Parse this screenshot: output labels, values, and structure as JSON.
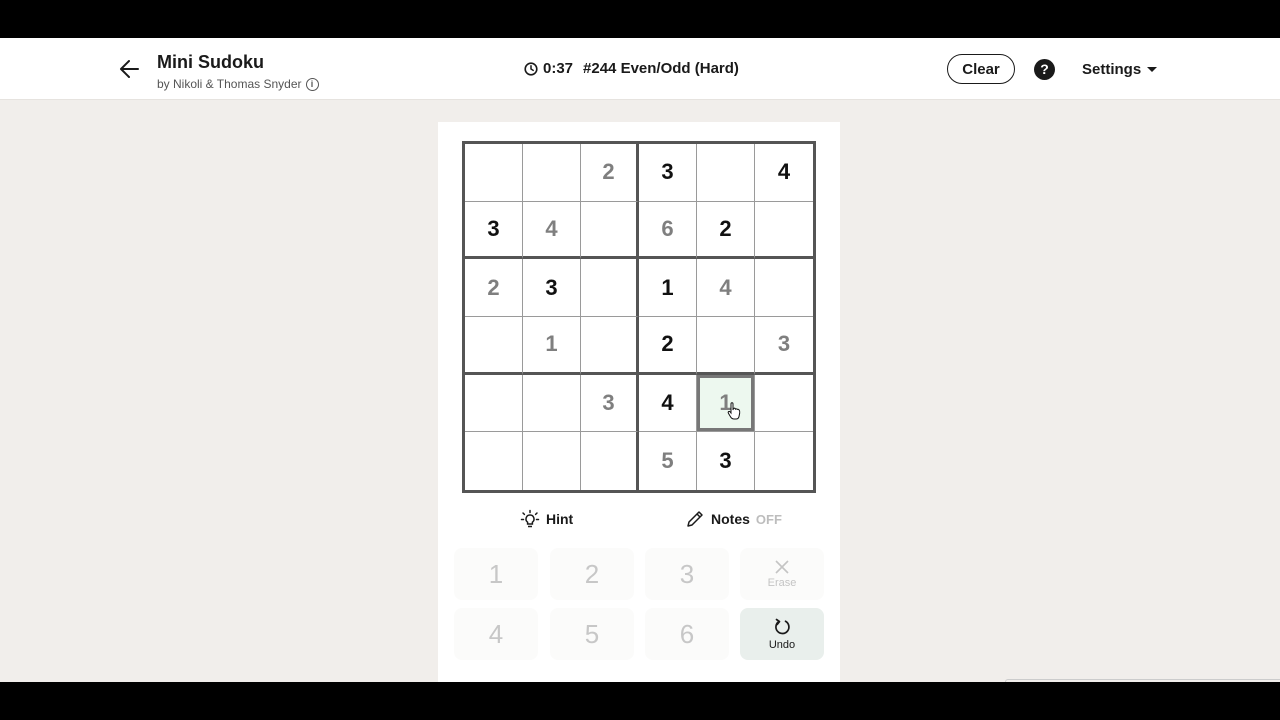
{
  "header": {
    "title": "Mini Sudoku",
    "byline": "by Nikoli & Thomas Snyder",
    "timer": "0:37",
    "puzzle_label": "#244 Even/Odd (Hard)",
    "clear_label": "Clear",
    "help_label": "?",
    "settings_label": "Settings"
  },
  "grid": {
    "rows": [
      [
        {
          "v": "",
          "t": "empty"
        },
        {
          "v": "",
          "t": "empty"
        },
        {
          "v": "2",
          "t": "entered"
        },
        {
          "v": "3",
          "t": "given"
        },
        {
          "v": "",
          "t": "empty"
        },
        {
          "v": "4",
          "t": "given"
        }
      ],
      [
        {
          "v": "3",
          "t": "given"
        },
        {
          "v": "4",
          "t": "entered"
        },
        {
          "v": "",
          "t": "empty"
        },
        {
          "v": "6",
          "t": "entered"
        },
        {
          "v": "2",
          "t": "given"
        },
        {
          "v": "",
          "t": "empty"
        }
      ],
      [
        {
          "v": "2",
          "t": "entered"
        },
        {
          "v": "3",
          "t": "given"
        },
        {
          "v": "",
          "t": "empty"
        },
        {
          "v": "1",
          "t": "given"
        },
        {
          "v": "4",
          "t": "entered"
        },
        {
          "v": "",
          "t": "empty"
        }
      ],
      [
        {
          "v": "",
          "t": "empty"
        },
        {
          "v": "1",
          "t": "entered"
        },
        {
          "v": "",
          "t": "empty"
        },
        {
          "v": "2",
          "t": "given"
        },
        {
          "v": "",
          "t": "empty"
        },
        {
          "v": "3",
          "t": "entered"
        }
      ],
      [
        {
          "v": "",
          "t": "empty"
        },
        {
          "v": "",
          "t": "empty"
        },
        {
          "v": "3",
          "t": "entered"
        },
        {
          "v": "4",
          "t": "given"
        },
        {
          "v": "1",
          "t": "entered",
          "selected": true
        },
        {
          "v": "",
          "t": "empty"
        }
      ],
      [
        {
          "v": "",
          "t": "empty"
        },
        {
          "v": "",
          "t": "empty"
        },
        {
          "v": "",
          "t": "empty"
        },
        {
          "v": "5",
          "t": "entered"
        },
        {
          "v": "3",
          "t": "given"
        },
        {
          "v": "",
          "t": "empty"
        }
      ]
    ]
  },
  "controls": {
    "hint_label": "Hint",
    "notes_label": "Notes",
    "notes_state": "OFF"
  },
  "keypad": {
    "digits": [
      "1",
      "2",
      "3",
      "4",
      "5",
      "6"
    ],
    "erase_label": "Erase",
    "undo_label": "Undo"
  },
  "colors": {
    "given": "#111111",
    "entered": "#7f7f7f",
    "selected_bg": "#edf8ef",
    "page_bg": "#f1eeeb"
  }
}
